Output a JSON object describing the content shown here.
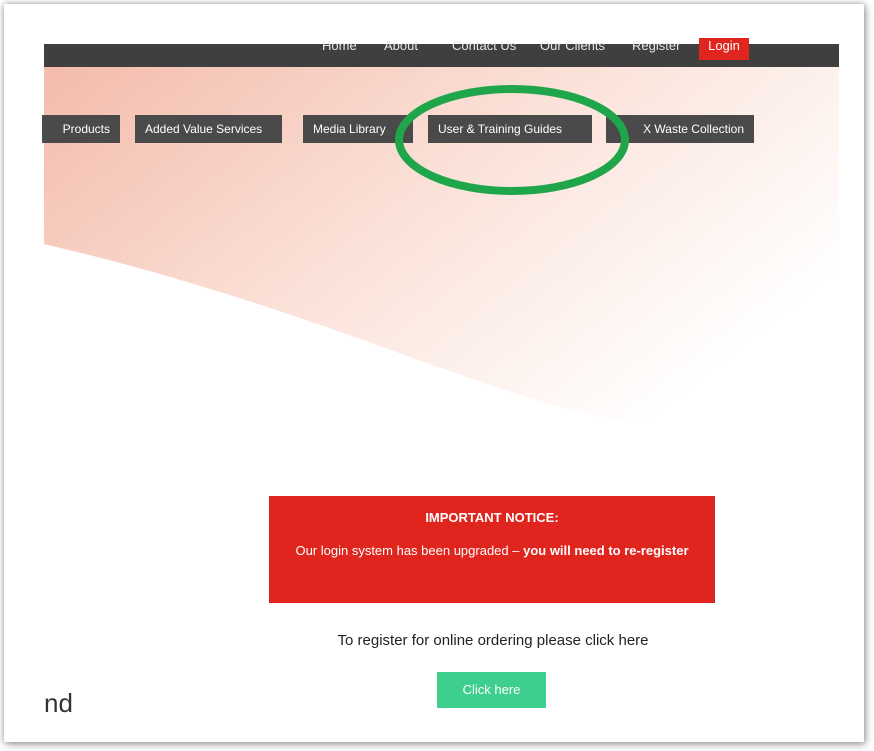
{
  "top_nav": {
    "items": [
      "Home",
      "About",
      "Contact Us",
      "Our Clients",
      "Register"
    ],
    "login_label": "Login"
  },
  "tabs": [
    "Products",
    "Added Value Services",
    "Media Library",
    "User & Training Guides",
    "X Waste Collection"
  ],
  "notice": {
    "title": "IMPORTANT NOTICE:",
    "body_prefix": "Our login system has been upgraded – ",
    "body_bold": "you will need to re-register"
  },
  "register_prompt": "To register for online ordering please click here",
  "cta_label": "Click here",
  "partial_text": "nd",
  "colors": {
    "nav_bg": "#3f3f3f",
    "tab_bg": "#4a4a4a",
    "accent_red": "#e0251e",
    "cta_green": "#3ecf8e",
    "highlight_green": "#1fa64a",
    "hero_peach": "#f6c9bd"
  }
}
